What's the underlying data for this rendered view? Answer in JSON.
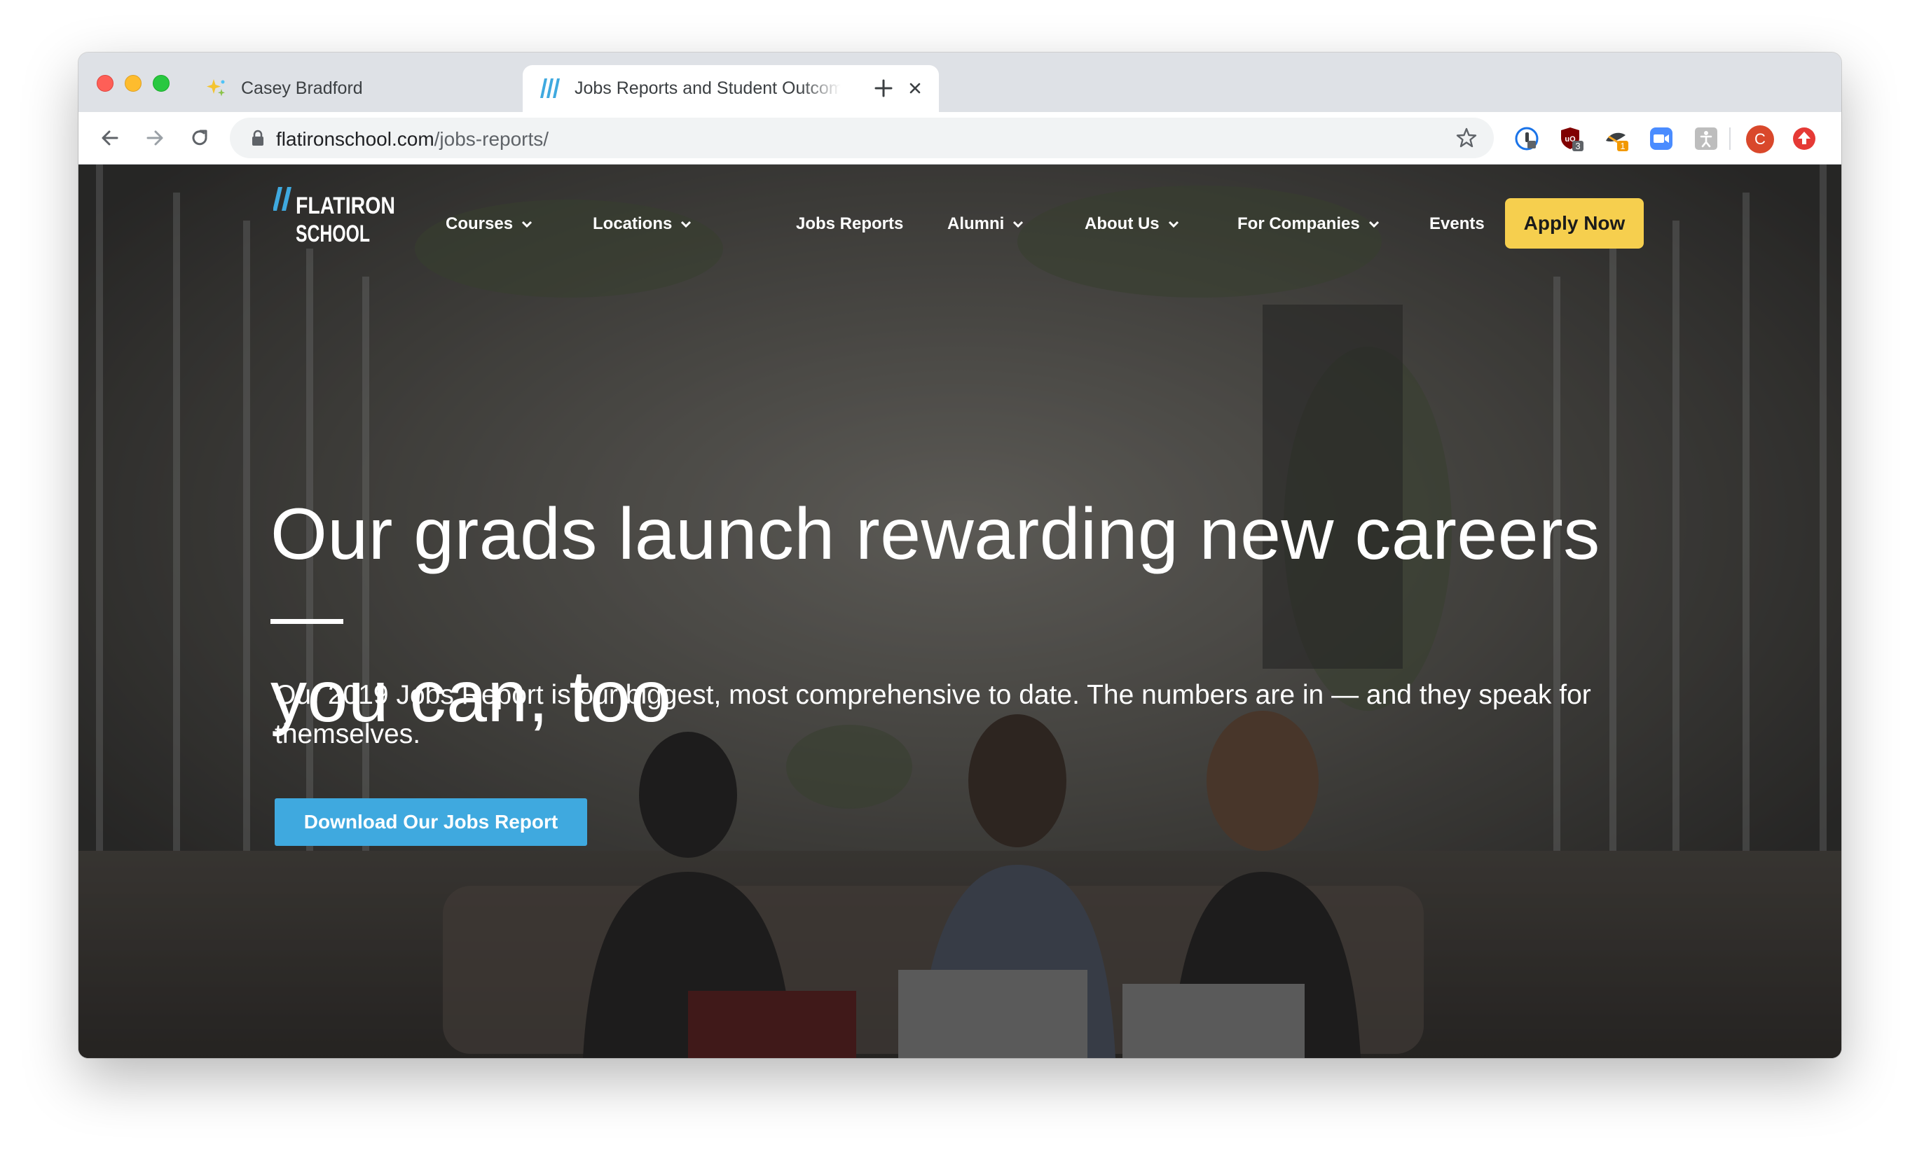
{
  "browser": {
    "tabs": [
      {
        "title": "Casey Bradford",
        "active": false,
        "favicon": "sparkle-icon"
      },
      {
        "title": "Jobs Reports and Student Outcomes",
        "active": true,
        "favicon": "flatiron-slashes-icon"
      }
    ],
    "url": {
      "host": "flatironschool.com",
      "path": "/jobs-reports/"
    },
    "extensions": [
      {
        "name": "1password-icon",
        "badge": ""
      },
      {
        "name": "ublock-shield-icon",
        "badge": "3"
      },
      {
        "name": "honey-icon",
        "badge": "1"
      },
      {
        "name": "zoom-icon",
        "badge": ""
      },
      {
        "name": "accessibility-extension-icon",
        "badge": ""
      }
    ],
    "profile_initial": "C",
    "colors": {
      "profile": "#d9482b",
      "update": "#e53935"
    }
  },
  "site": {
    "logo": {
      "line1": "FLATIRON",
      "line2": "SCHOOL"
    },
    "nav": [
      {
        "label": "Courses",
        "dropdown": true
      },
      {
        "label": "Locations",
        "dropdown": true
      },
      {
        "label": "Jobs Reports",
        "dropdown": false
      },
      {
        "label": "Alumni",
        "dropdown": true
      },
      {
        "label": "About Us",
        "dropdown": true
      },
      {
        "label": "For Companies",
        "dropdown": true
      },
      {
        "label": "Events",
        "dropdown": false
      }
    ],
    "apply_label": "Apply Now",
    "hero": {
      "headline_line1": "Our grads launch rewarding new careers —",
      "headline_line2": "you can, too",
      "subhead": "Our 2019 Jobs Report is our biggest, most comprehensive to date. The numbers are in — and they speak for themselves.",
      "cta_label": "Download Our Jobs Report"
    },
    "colors": {
      "brand_blue": "#3fa9df",
      "apply_yellow": "#f6cf4e"
    }
  }
}
